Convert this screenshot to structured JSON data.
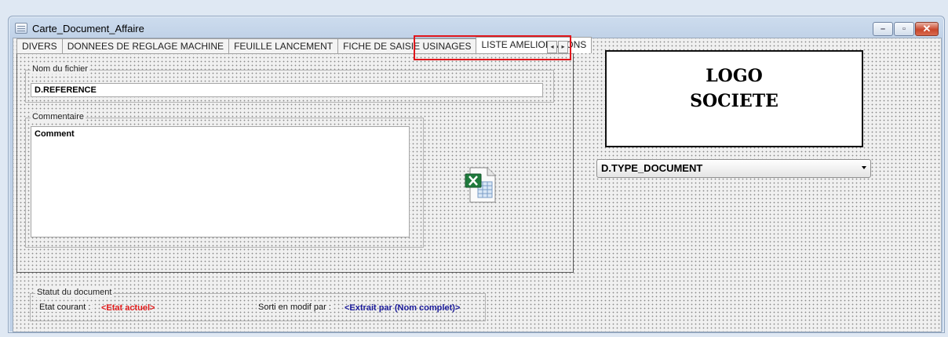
{
  "window": {
    "title": "Carte_Document_Affaire",
    "buttons": [
      "minimize",
      "maximize",
      "close"
    ]
  },
  "tabs": [
    {
      "label": "DIVERS",
      "active": false
    },
    {
      "label": "DONNEES DE REGLAGE MACHINE",
      "active": false
    },
    {
      "label": "FEUILLE LANCEMENT",
      "active": false
    },
    {
      "label": "FICHE DE SAISIE USINAGES",
      "active": false
    },
    {
      "label": "LISTE AMELIORATIONS",
      "active": true
    }
  ],
  "tab_scroll": {
    "left": "◂",
    "right": "▸"
  },
  "nom_fichier": {
    "legend": "Nom du fichier",
    "value": "D.REFERENCE"
  },
  "commentaire": {
    "legend": "Commentaire",
    "value": "Comment"
  },
  "logo": {
    "line1": "LOGO",
    "line2": "SOCIETE"
  },
  "type_document": {
    "value": "D.TYPE_DOCUMENT"
  },
  "statut": {
    "legend": "Statut du document",
    "etat_label": "Etat courant :",
    "etat_value": "<Etat actuel>",
    "sorti_label": "Sorti en modif par :",
    "sorti_value": "<Extrait par (Nom complet)>"
  },
  "colors": {
    "highlight": "#e0161b",
    "etat": "#e01b1b",
    "sorti": "#1a1a9a"
  },
  "icons": [
    "window-app-icon",
    "excel-file-icon",
    "dropdown-arrow-icon"
  ]
}
